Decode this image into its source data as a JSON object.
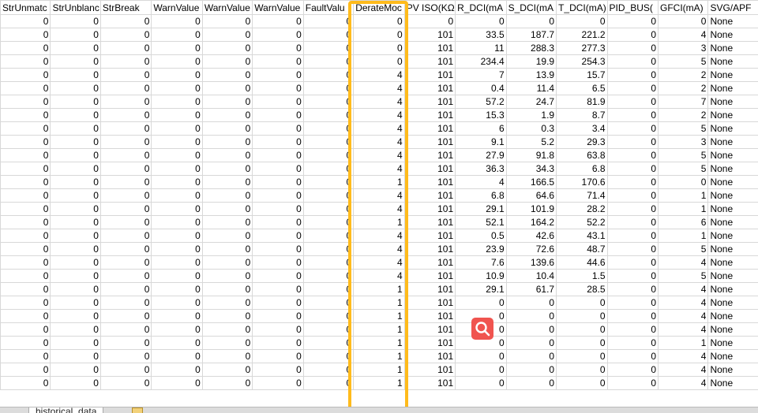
{
  "sheet": {
    "headers": [
      "StrUnmatc",
      "StrUnblanc",
      "StrBreak",
      "WarnValue",
      "WarnValue",
      "WarnValue",
      "FaultValu",
      "DerateMoc",
      "PV ISO(KΩ",
      "R_DCI(mA",
      "S_DCI(mA",
      "T_DCI(mA)",
      "PID_BUS(",
      "GFCI(mA)",
      "SVG/APF"
    ],
    "rows": [
      [
        "0",
        "0",
        "0",
        "0",
        "0",
        "0",
        "0",
        "0",
        "0",
        "0",
        "0",
        "0",
        "0",
        "0",
        "None"
      ],
      [
        "0",
        "0",
        "0",
        "0",
        "0",
        "0",
        "0",
        "0",
        "101",
        "33.5",
        "187.7",
        "221.2",
        "0",
        "4",
        "None"
      ],
      [
        "0",
        "0",
        "0",
        "0",
        "0",
        "0",
        "0",
        "0",
        "101",
        "11",
        "288.3",
        "277.3",
        "0",
        "3",
        "None"
      ],
      [
        "0",
        "0",
        "0",
        "0",
        "0",
        "0",
        "0",
        "0",
        "101",
        "234.4",
        "19.9",
        "254.3",
        "0",
        "5",
        "None"
      ],
      [
        "0",
        "0",
        "0",
        "0",
        "0",
        "0",
        "0",
        "4",
        "101",
        "7",
        "13.9",
        "15.7",
        "0",
        "2",
        "None"
      ],
      [
        "0",
        "0",
        "0",
        "0",
        "0",
        "0",
        "0",
        "4",
        "101",
        "0.4",
        "11.4",
        "6.5",
        "0",
        "2",
        "None"
      ],
      [
        "0",
        "0",
        "0",
        "0",
        "0",
        "0",
        "0",
        "4",
        "101",
        "57.2",
        "24.7",
        "81.9",
        "0",
        "7",
        "None"
      ],
      [
        "0",
        "0",
        "0",
        "0",
        "0",
        "0",
        "0",
        "4",
        "101",
        "15.3",
        "1.9",
        "8.7",
        "0",
        "2",
        "None"
      ],
      [
        "0",
        "0",
        "0",
        "0",
        "0",
        "0",
        "0",
        "4",
        "101",
        "6",
        "0.3",
        "3.4",
        "0",
        "5",
        "None"
      ],
      [
        "0",
        "0",
        "0",
        "0",
        "0",
        "0",
        "0",
        "4",
        "101",
        "9.1",
        "5.2",
        "29.3",
        "0",
        "3",
        "None"
      ],
      [
        "0",
        "0",
        "0",
        "0",
        "0",
        "0",
        "0",
        "4",
        "101",
        "27.9",
        "91.8",
        "63.8",
        "0",
        "5",
        "None"
      ],
      [
        "0",
        "0",
        "0",
        "0",
        "0",
        "0",
        "0",
        "4",
        "101",
        "36.3",
        "34.3",
        "6.8",
        "0",
        "5",
        "None"
      ],
      [
        "0",
        "0",
        "0",
        "0",
        "0",
        "0",
        "0",
        "1",
        "101",
        "4",
        "166.5",
        "170.6",
        "0",
        "0",
        "None"
      ],
      [
        "0",
        "0",
        "0",
        "0",
        "0",
        "0",
        "0",
        "4",
        "101",
        "6.8",
        "64.6",
        "71.4",
        "0",
        "1",
        "None"
      ],
      [
        "0",
        "0",
        "0",
        "0",
        "0",
        "0",
        "0",
        "4",
        "101",
        "29.1",
        "101.9",
        "28.2",
        "0",
        "1",
        "None"
      ],
      [
        "0",
        "0",
        "0",
        "0",
        "0",
        "0",
        "0",
        "1",
        "101",
        "52.1",
        "164.2",
        "52.2",
        "0",
        "6",
        "None"
      ],
      [
        "0",
        "0",
        "0",
        "0",
        "0",
        "0",
        "0",
        "4",
        "101",
        "0.5",
        "42.6",
        "43.1",
        "0",
        "1",
        "None"
      ],
      [
        "0",
        "0",
        "0",
        "0",
        "0",
        "0",
        "0",
        "4",
        "101",
        "23.9",
        "72.6",
        "48.7",
        "0",
        "5",
        "None"
      ],
      [
        "0",
        "0",
        "0",
        "0",
        "0",
        "0",
        "0",
        "4",
        "101",
        "7.6",
        "139.6",
        "44.6",
        "0",
        "4",
        "None"
      ],
      [
        "0",
        "0",
        "0",
        "0",
        "0",
        "0",
        "0",
        "4",
        "101",
        "10.9",
        "10.4",
        "1.5",
        "0",
        "5",
        "None"
      ],
      [
        "0",
        "0",
        "0",
        "0",
        "0",
        "0",
        "0",
        "1",
        "101",
        "29.1",
        "61.7",
        "28.5",
        "0",
        "4",
        "None"
      ],
      [
        "0",
        "0",
        "0",
        "0",
        "0",
        "0",
        "0",
        "1",
        "101",
        "0",
        "0",
        "0",
        "0",
        "4",
        "None"
      ],
      [
        "0",
        "0",
        "0",
        "0",
        "0",
        "0",
        "0",
        "1",
        "101",
        "0",
        "0",
        "0",
        "0",
        "4",
        "None"
      ],
      [
        "0",
        "0",
        "0",
        "0",
        "0",
        "0",
        "0",
        "1",
        "101",
        "0",
        "0",
        "0",
        "0",
        "4",
        "None"
      ],
      [
        "0",
        "0",
        "0",
        "0",
        "0",
        "0",
        "0",
        "1",
        "101",
        "0",
        "0",
        "0",
        "0",
        "1",
        "None"
      ],
      [
        "0",
        "0",
        "0",
        "0",
        "0",
        "0",
        "0",
        "1",
        "101",
        "0",
        "0",
        "0",
        "0",
        "4",
        "None"
      ],
      [
        "0",
        "0",
        "0",
        "0",
        "0",
        "0",
        "0",
        "1",
        "101",
        "0",
        "0",
        "0",
        "0",
        "4",
        "None"
      ],
      [
        "0",
        "0",
        "0",
        "0",
        "0",
        "0",
        "0",
        "1",
        "101",
        "0",
        "0",
        "0",
        "0",
        "4",
        "None"
      ]
    ],
    "highlighted_column": "DerateMoc",
    "sheet_tab": "historical_data",
    "highlight_color": "#ffbb1c"
  },
  "icons": {
    "search": "search-icon",
    "add_sheet": "add-sheet-icon"
  }
}
